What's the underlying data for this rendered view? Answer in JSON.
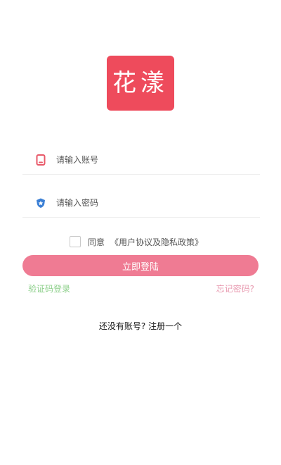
{
  "logo": {
    "text": "花漾"
  },
  "phone_field": {
    "placeholder": "请输入账号",
    "icon": "phone-icon",
    "icon_color": "#e85a6a"
  },
  "password_field": {
    "placeholder": "请输入密码",
    "icon": "shield-icon",
    "icon_color": "#3a7fd5"
  },
  "agreement": {
    "checked": false,
    "prefix": "同意",
    "link": "《用户协议及隐私政策》"
  },
  "login_button": {
    "label": "立即登陆",
    "color": "#ef7b93"
  },
  "sms_login": {
    "label": "验证码登录",
    "color": "#8ccf8a"
  },
  "forgot_password": {
    "label": "忘记密码?",
    "color": "#e89ab0"
  },
  "register_prompt": {
    "label": "还没有账号? 注册一个"
  }
}
